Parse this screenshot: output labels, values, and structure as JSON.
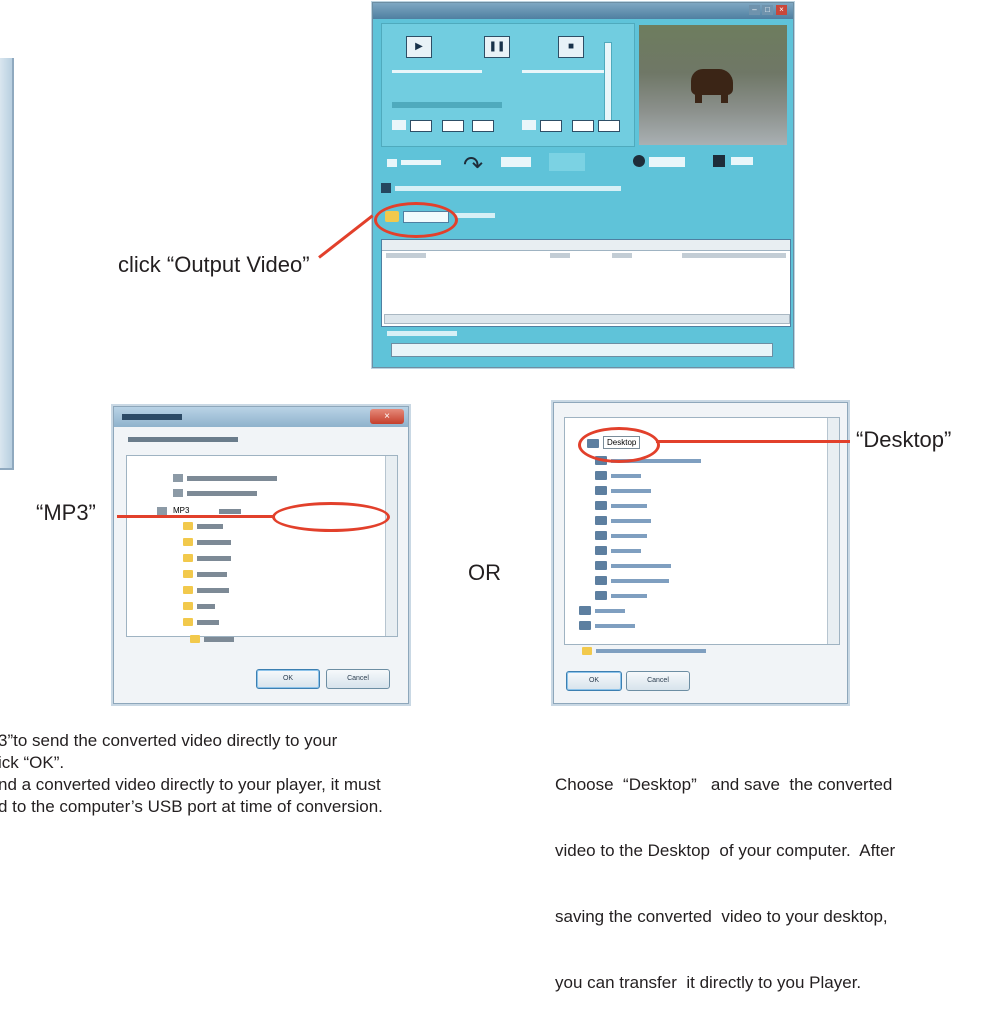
{
  "annotations": {
    "output_video": "click “Output Video”",
    "mp3": "“MP3”",
    "or": "OR",
    "desktop": "“Desktop”"
  },
  "dialog_mp3": {
    "selected_item": "MP3",
    "ok_label": "OK",
    "cancel_label": "Cancel"
  },
  "dialog_desktop": {
    "selected_item": "Desktop",
    "ok_label": "OK",
    "cancel_label": "Cancel"
  },
  "instructions": {
    "left_line1": "3”to send the converted video directly to your",
    "left_line2": "ick “OK”.",
    "left_line3": "nd a converted video directly to your player, it must",
    "left_line4": "d to the computer’s USB port at time of conversion.",
    "right_line1": "Choose  “Desktop”   and save  the converted",
    "right_line2": "video to the Desktop  of your computer.  After",
    "right_line3": "saving the converted  video to your desktop,",
    "right_line4": "you can transfer  it directly to you Player."
  },
  "colors": {
    "accent_red": "#e2402b",
    "converter_bg": "#5fc3d9"
  }
}
